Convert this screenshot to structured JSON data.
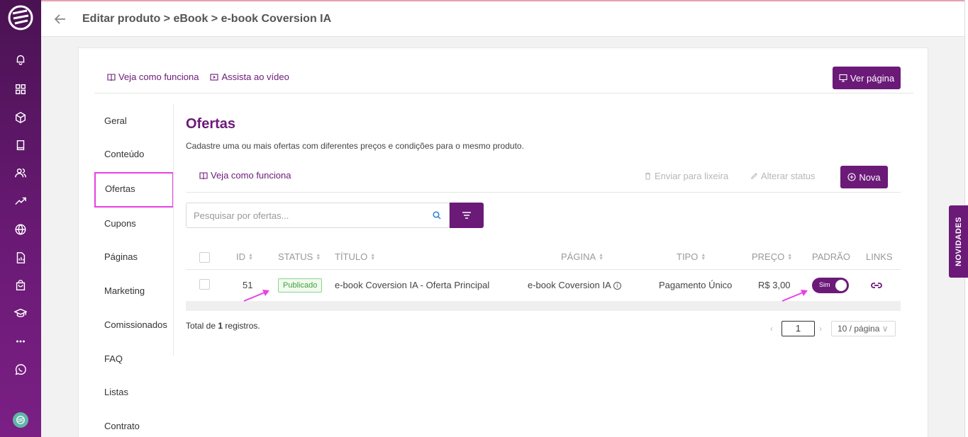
{
  "breadcrumb": "Editar produto > eBook > e-book Coversion IA",
  "help": {
    "veja": "Veja como funciona",
    "assista": "Assista ao vídeo",
    "ver_pagina": "Ver página"
  },
  "submenu": [
    "Geral",
    "Conteúdo",
    "Ofertas",
    "Cupons",
    "Páginas",
    "Marketing",
    "Comissionados",
    "FAQ",
    "Listas",
    "Contrato"
  ],
  "section": {
    "title": "Ofertas",
    "subtitle": "Cadastre uma ou mais ofertas com diferentes preços e condições para o mesmo produto.",
    "veja": "Veja como funciona",
    "lixeira": "Enviar para lixeira",
    "alterar_status": "Alterar status",
    "nova": "Nova"
  },
  "search": {
    "placeholder": "Pesquisar por ofertas..."
  },
  "table": {
    "headers": {
      "id": "ID",
      "status": "STATUS",
      "titulo": "TÍTULO",
      "pagina": "PÁGINA",
      "tipo": "TIPO",
      "preco": "PREÇO",
      "padrao": "PADRÃO",
      "links": "LINKS"
    },
    "rows": [
      {
        "id": "51",
        "status": "Publicado",
        "titulo": "e-book Coversion IA - Oferta Principal",
        "pagina": "e-book Coversion IA",
        "tipo": "Pagamento Único",
        "preco": "R$ 3,00",
        "padrao": "Sim"
      }
    ]
  },
  "footer": {
    "total_prefix": "Total de ",
    "total_count": "1",
    "total_suffix": " registros.",
    "page": "1",
    "page_size": "10 / página"
  },
  "side_tab": "NOVIDADES",
  "colors": {
    "brand": "#6b1a78",
    "highlight": "#e940e3"
  }
}
